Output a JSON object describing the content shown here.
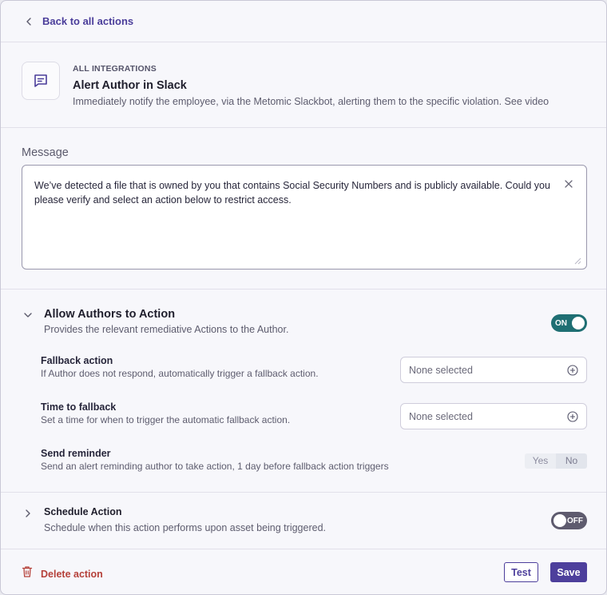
{
  "nav": {
    "back_label": "Back to all actions"
  },
  "integration": {
    "eyebrow": "ALL INTEGRATIONS",
    "title": "Alert Author in Slack",
    "description": "Immediately notify the employee, via the Metomic Slackbot, alerting them to the specific violation. See video",
    "icon": "message-icon"
  },
  "message": {
    "label": "Message",
    "text": "We’ve detected a file that is owned by you that contains Social Security Numbers and is publicly available. Could you please verify and select an action below to restrict access."
  },
  "allow_authors": {
    "title": "Allow Authors to Action",
    "description": "Provides the relevant remediative Actions to the Author.",
    "toggle_label": "ON",
    "fallback": {
      "title": "Fallback action",
      "description": "If Author does not respond, automatically trigger a fallback action.",
      "placeholder": "None selected"
    },
    "time_to_fallback": {
      "title": "Time to fallback",
      "description": "Set a time for when to trigger the automatic fallback action.",
      "placeholder": "None selected"
    },
    "reminder": {
      "title": "Send reminder",
      "description": "Send an alert reminding author to take action, 1 day before fallback action triggers",
      "yes_label": "Yes",
      "no_label": "No"
    }
  },
  "schedule": {
    "title": "Schedule Action",
    "description": "Schedule when this action performs upon asset being triggered.",
    "toggle_label": "OFF"
  },
  "footer": {
    "delete_label": "Delete action",
    "test_label": "Test",
    "save_label": "Save"
  },
  "colors": {
    "accent": "#4d3f9c",
    "toggle_on": "#1f6f73",
    "toggle_off": "#5e5b6e",
    "danger": "#b5413a"
  }
}
